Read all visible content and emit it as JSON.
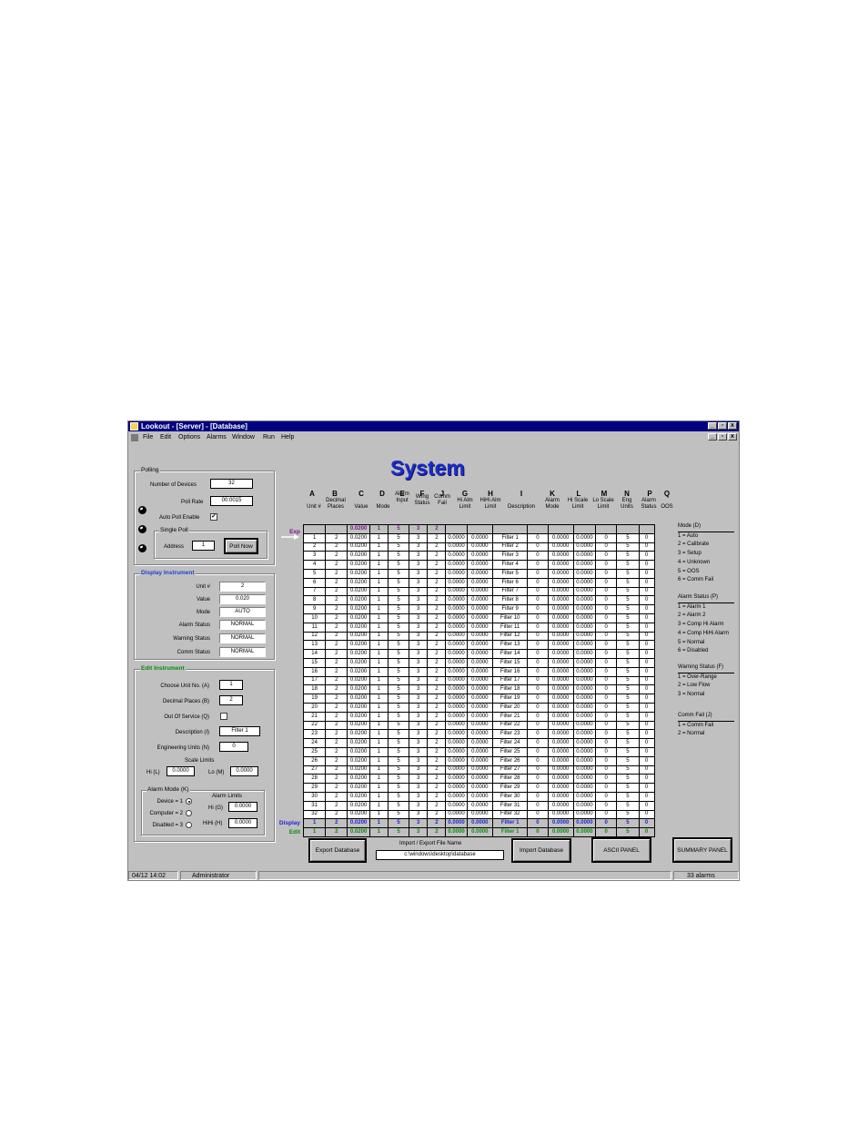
{
  "window": {
    "title": "Lookout - [Server] - [Database]",
    "title_buttons": [
      "_",
      "▫",
      "x"
    ]
  },
  "menu": [
    "File",
    "Edit",
    "Options",
    "Alarms",
    "Window",
    "Run",
    "Help"
  ],
  "panel_title": "System",
  "polling": {
    "group_label": "Polling",
    "num_devices_label": "Number of Devices",
    "num_devices": "32",
    "poll_rate_label": "Poll Rate",
    "poll_rate": "00:0015",
    "auto_poll_label": "Auto Poll Enable",
    "auto_poll_checked": "✓",
    "single_poll_label": "Single Poll",
    "address_label": "Address",
    "address": "1",
    "poll_now_label": "Poll Now"
  },
  "display_instrument": {
    "group_label": "Display Instrument",
    "fields": [
      {
        "label": "Unit #",
        "value": "2"
      },
      {
        "label": "Value",
        "value": "0.020"
      },
      {
        "label": "Mode",
        "value": "AUTO"
      },
      {
        "label": "Alarm Status",
        "value": "NORMAL"
      },
      {
        "label": "Warning Status",
        "value": "NORMAL"
      },
      {
        "label": "Comm Status",
        "value": "NORMAL"
      }
    ]
  },
  "edit_instrument": {
    "group_label": "Edit Instrument",
    "choose_unit_label": "Choose Unit No. (A)",
    "choose_unit": "1",
    "decimal_places_label": "Decimal Places (B)",
    "decimal_places": "2",
    "oos_label": "Out Of Service (Q)",
    "description_label": "Description (I)",
    "description": "Filter 1",
    "eng_units_label": "Engineering Units (N)",
    "eng_units": "0",
    "scale_limits_label": "Scale Limits",
    "hi_label": "Hi (L)",
    "hi_value": "0.0000",
    "lo_label": "Lo (M)",
    "lo_value": "0.0000",
    "alarm_mode_label": "Alarm Mode (K)",
    "alarm_limits_label": "Alarm Limits",
    "device_label": "Device = 1",
    "computer_label": "Computer = 2",
    "disabled_label": "Disabled = 3",
    "hi_alarm_label": "Hi (G)",
    "hi_alarm_value": "0.0000",
    "hihi_alarm_label": "HiHi (H)",
    "hihi_alarm_value": "0.0000"
  },
  "grid": {
    "column_letters": [
      "A",
      "B",
      "C",
      "D",
      "E",
      "F",
      "J",
      "G",
      "H",
      "I",
      "K",
      "L",
      "M",
      "N",
      "P",
      "Q"
    ],
    "column_headers": [
      "Unit #",
      "Decimal\nPlaces",
      "Value",
      "Mode",
      "Alarm\nInput",
      "Wrng\nStatus",
      "Comm\nFail",
      "Hi Alm\nLimit",
      "HiHi Alm\nLimit",
      "Description",
      "Alarm\nMode",
      "Hi Scale\nLimit",
      "Lo Scale\nLimit",
      "Eng\nUnits",
      "Alarm\nStatus",
      "OOS"
    ],
    "exp_row": {
      "label": "Exp",
      "cells": [
        "",
        "",
        "0.0200",
        "1",
        "5",
        "3",
        "2",
        "",
        "",
        "",
        "",
        "",
        "",
        "",
        "",
        ""
      ]
    },
    "rows": [
      [
        "1",
        "2",
        "0.0200",
        "1",
        "5",
        "3",
        "2",
        "0.0000",
        "0.0000",
        "Filter 1",
        "0",
        "0.0000",
        "0.0000",
        "0",
        "5",
        "0"
      ],
      [
        "2",
        "2",
        "0.0200",
        "1",
        "5",
        "3",
        "2",
        "0.0000",
        "0.0000",
        "Filter 2",
        "0",
        "0.0000",
        "0.0000",
        "0",
        "5",
        "0"
      ],
      [
        "3",
        "2",
        "0.0200",
        "1",
        "5",
        "3",
        "2",
        "0.0000",
        "0.0000",
        "Filter 3",
        "0",
        "0.0000",
        "0.0000",
        "0",
        "5",
        "0"
      ],
      [
        "4",
        "2",
        "0.0200",
        "1",
        "5",
        "3",
        "2",
        "0.0000",
        "0.0000",
        "Filter 4",
        "0",
        "0.0000",
        "0.0000",
        "0",
        "5",
        "0"
      ],
      [
        "5",
        "2",
        "0.0200",
        "1",
        "5",
        "3",
        "2",
        "0.0000",
        "0.0000",
        "Filter 5",
        "0",
        "0.0000",
        "0.0000",
        "0",
        "5",
        "0"
      ],
      [
        "6",
        "2",
        "0.0200",
        "1",
        "5",
        "3",
        "2",
        "0.0000",
        "0.0000",
        "Filter 6",
        "0",
        "0.0000",
        "0.0000",
        "0",
        "5",
        "0"
      ],
      [
        "7",
        "2",
        "0.0200",
        "1",
        "5",
        "3",
        "2",
        "0.0000",
        "0.0000",
        "Filter 7",
        "0",
        "0.0000",
        "0.0000",
        "0",
        "5",
        "0"
      ],
      [
        "8",
        "2",
        "0.0200",
        "1",
        "5",
        "3",
        "2",
        "0.0000",
        "0.0000",
        "Filter 8",
        "0",
        "0.0000",
        "0.0000",
        "0",
        "5",
        "0"
      ],
      [
        "9",
        "2",
        "0.0200",
        "1",
        "5",
        "3",
        "2",
        "0.0000",
        "0.0000",
        "Filter 9",
        "0",
        "0.0000",
        "0.0000",
        "0",
        "5",
        "0"
      ],
      [
        "10",
        "2",
        "0.0200",
        "1",
        "5",
        "3",
        "2",
        "0.0000",
        "0.0000",
        "Filter 10",
        "0",
        "0.0000",
        "0.0000",
        "0",
        "5",
        "0"
      ],
      [
        "11",
        "2",
        "0.0200",
        "1",
        "5",
        "3",
        "2",
        "0.0000",
        "0.0000",
        "Filter 11",
        "0",
        "0.0000",
        "0.0000",
        "0",
        "5",
        "0"
      ],
      [
        "12",
        "2",
        "0.0200",
        "1",
        "5",
        "3",
        "2",
        "0.0000",
        "0.0000",
        "Filter 12",
        "0",
        "0.0000",
        "0.0000",
        "0",
        "5",
        "0"
      ],
      [
        "13",
        "2",
        "0.0200",
        "1",
        "5",
        "3",
        "2",
        "0.0000",
        "0.0000",
        "Filter 13",
        "0",
        "0.0000",
        "0.0000",
        "0",
        "5",
        "0"
      ],
      [
        "14",
        "2",
        "0.0200",
        "1",
        "5",
        "3",
        "2",
        "0.0000",
        "0.0000",
        "Filter 14",
        "0",
        "0.0000",
        "0.0000",
        "0",
        "5",
        "0"
      ],
      [
        "15",
        "2",
        "0.0200",
        "1",
        "5",
        "3",
        "2",
        "0.0000",
        "0.0000",
        "Filter 15",
        "0",
        "0.0000",
        "0.0000",
        "0",
        "5",
        "0"
      ],
      [
        "16",
        "2",
        "0.0200",
        "1",
        "5",
        "3",
        "2",
        "0.0000",
        "0.0000",
        "Filter 16",
        "0",
        "0.0000",
        "0.0000",
        "0",
        "5",
        "0"
      ],
      [
        "17",
        "2",
        "0.0200",
        "1",
        "5",
        "3",
        "2",
        "0.0000",
        "0.0000",
        "Filter 17",
        "0",
        "0.0000",
        "0.0000",
        "0",
        "5",
        "0"
      ],
      [
        "18",
        "2",
        "0.0200",
        "1",
        "5",
        "3",
        "2",
        "0.0000",
        "0.0000",
        "Filter 18",
        "0",
        "0.0000",
        "0.0000",
        "0",
        "5",
        "0"
      ],
      [
        "19",
        "2",
        "0.0200",
        "1",
        "5",
        "3",
        "2",
        "0.0000",
        "0.0000",
        "Filter 19",
        "0",
        "0.0000",
        "0.0000",
        "0",
        "5",
        "0"
      ],
      [
        "20",
        "2",
        "0.0200",
        "1",
        "5",
        "3",
        "2",
        "0.0000",
        "0.0000",
        "Filter 20",
        "0",
        "0.0000",
        "0.0000",
        "0",
        "5",
        "0"
      ],
      [
        "21",
        "2",
        "0.0200",
        "1",
        "5",
        "3",
        "2",
        "0.0000",
        "0.0000",
        "Filter 21",
        "0",
        "0.0000",
        "0.0000",
        "0",
        "5",
        "0"
      ],
      [
        "22",
        "2",
        "0.0200",
        "1",
        "5",
        "3",
        "2",
        "0.0000",
        "0.0000",
        "Filter 22",
        "0",
        "0.0000",
        "0.0000",
        "0",
        "5",
        "0"
      ],
      [
        "23",
        "2",
        "0.0200",
        "1",
        "5",
        "3",
        "2",
        "0.0000",
        "0.0000",
        "Filter 23",
        "0",
        "0.0000",
        "0.0000",
        "0",
        "5",
        "0"
      ],
      [
        "24",
        "2",
        "0.0200",
        "1",
        "5",
        "3",
        "2",
        "0.0000",
        "0.0000",
        "Filter 24",
        "0",
        "0.0000",
        "0.0000",
        "0",
        "5",
        "0"
      ],
      [
        "25",
        "2",
        "0.0200",
        "1",
        "5",
        "3",
        "2",
        "0.0000",
        "0.0000",
        "Filter 25",
        "0",
        "0.0000",
        "0.0000",
        "0",
        "5",
        "0"
      ],
      [
        "26",
        "2",
        "0.0200",
        "1",
        "5",
        "3",
        "2",
        "0.0000",
        "0.0000",
        "Filter 26",
        "0",
        "0.0000",
        "0.0000",
        "0",
        "5",
        "0"
      ],
      [
        "27",
        "2",
        "0.0200",
        "1",
        "5",
        "3",
        "2",
        "0.0000",
        "0.0000",
        "Filter 27",
        "0",
        "0.0000",
        "0.0000",
        "0",
        "5",
        "0"
      ],
      [
        "28",
        "2",
        "0.0200",
        "1",
        "5",
        "3",
        "2",
        "0.0000",
        "0.0000",
        "Filter 28",
        "0",
        "0.0000",
        "0.0000",
        "0",
        "5",
        "0"
      ],
      [
        "29",
        "2",
        "0.0200",
        "1",
        "5",
        "3",
        "2",
        "0.0000",
        "0.0000",
        "Filter 29",
        "0",
        "0.0000",
        "0.0000",
        "0",
        "5",
        "0"
      ],
      [
        "30",
        "2",
        "0.0200",
        "1",
        "5",
        "3",
        "2",
        "0.0000",
        "0.0000",
        "Filter 30",
        "0",
        "0.0000",
        "0.0000",
        "0",
        "5",
        "0"
      ],
      [
        "31",
        "2",
        "0.0200",
        "1",
        "5",
        "3",
        "2",
        "0.0000",
        "0.0000",
        "Filter 31",
        "0",
        "0.0000",
        "0.0000",
        "0",
        "5",
        "0"
      ],
      [
        "32",
        "2",
        "0.0200",
        "1",
        "5",
        "3",
        "2",
        "0.0000",
        "0.0000",
        "Filter 32",
        "0",
        "0.0000",
        "0.0000",
        "0",
        "5",
        "0"
      ]
    ],
    "display_row": {
      "label": "Display",
      "cells": [
        "1",
        "2",
        "0.0200",
        "1",
        "5",
        "3",
        "2",
        "0.0000",
        "0.0000",
        "Filter 1",
        "0",
        "0.0000",
        "0.0000",
        "0",
        "5",
        "0"
      ]
    },
    "edit_row": {
      "label": "Edit",
      "cells": [
        "1",
        "2",
        "0.0200",
        "1",
        "5",
        "3",
        "2",
        "0.0000",
        "0.0000",
        "Filter 1",
        "0",
        "0.0000",
        "0.0000",
        "0",
        "5",
        "0"
      ]
    }
  },
  "legend": [
    {
      "title": "Mode (D)",
      "items": [
        "1 = Auto",
        "2 = Calibrate",
        "3 = Setup",
        "4 = Unknown",
        "5 = OOS",
        "6 = Comm Fail"
      ]
    },
    {
      "title": "Alarm Status (P)",
      "items": [
        "1 = Alarm 1",
        "2 = Alarm 2",
        "3 = Comp Hi Alarm",
        "4 = Comp HiHi Alarm",
        "5 = Normal",
        "6 = Disabled"
      ]
    },
    {
      "title": "Warning Status (F)",
      "items": [
        "1 = Over-Range",
        "2 = Low Flow",
        "3 = Normal"
      ]
    },
    {
      "title": "Comm Fail (J)",
      "items": [
        "1 = Comm Fail",
        "2 = Normal"
      ]
    }
  ],
  "buttons": {
    "export": "Export Database",
    "import_export_label": "Import / Export File Name",
    "file_name": "c:\\windows\\desktop\\database",
    "import": "Import Database",
    "ascii": "ASCII PANEL",
    "summary": "SUMMARY PANEL"
  },
  "status": {
    "datetime": "04/12 14:02",
    "user": "Administrator",
    "alarms": "33 alarms"
  }
}
